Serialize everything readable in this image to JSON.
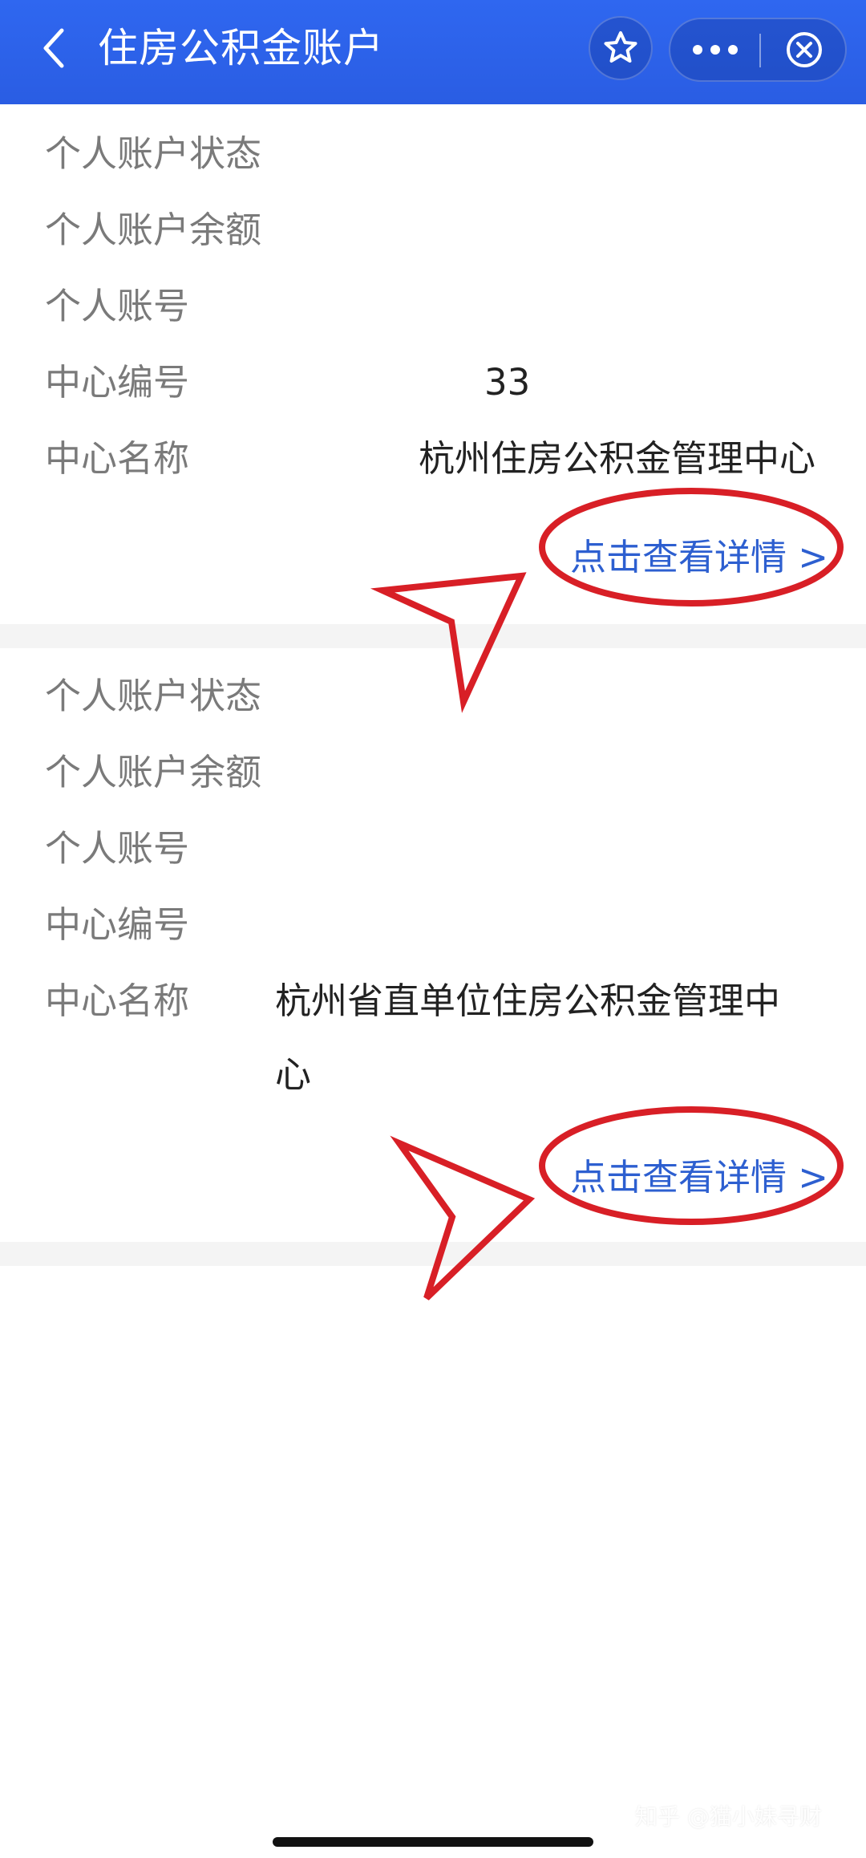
{
  "header": {
    "title": "住房公积金账户"
  },
  "accounts": [
    {
      "labels": {
        "status": "个人账户状态",
        "balance": "个人账户余额",
        "number": "个人账号",
        "center_code": "中心编号",
        "center_name": "中心名称"
      },
      "values": {
        "center_code": "33",
        "center_name": "杭州住房公积金管理中心"
      },
      "detail_link": "点击查看详情 >"
    },
    {
      "labels": {
        "status": "个人账户状态",
        "balance": "个人账户余额",
        "number": "个人账号",
        "center_code": "中心编号",
        "center_name": "中心名称"
      },
      "values": {
        "center_name_line1": "杭州省直单位住房公积金管理中",
        "center_name_line2": "心"
      },
      "detail_link": "点击查看详情 >"
    }
  ],
  "watermark": "知乎 @猫小妹寻财",
  "icons": {
    "back": "chevron-left-icon",
    "favorite": "star-icon",
    "more": "more-icon",
    "close": "close-circle-icon"
  },
  "colors": {
    "header": "#2f67f0",
    "link": "#2d5fd0",
    "annotation": "#d81f26",
    "label": "#7a7a7a"
  }
}
